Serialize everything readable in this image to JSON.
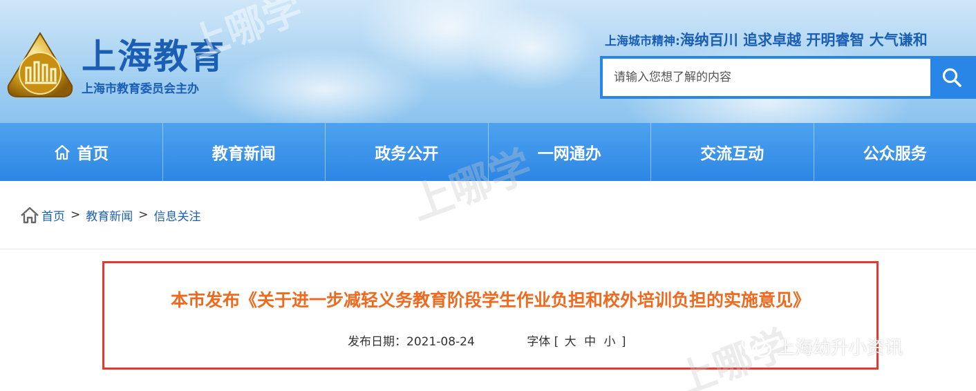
{
  "header": {
    "site_title": "上海教育",
    "site_subtitle": "上海市教育委员会主办",
    "spirit_lead": "上海城市精神:",
    "spirit_text": "海纳百川 追求卓越 开明睿智 大气谦和"
  },
  "search": {
    "placeholder": "请输入您想了解的内容",
    "icon": "search-icon"
  },
  "nav": {
    "items": [
      {
        "label": "首页",
        "icon": "home-icon"
      },
      {
        "label": "教育新闻"
      },
      {
        "label": "政务公开"
      },
      {
        "label": "一网通办"
      },
      {
        "label": "交流互动"
      },
      {
        "label": "公众服务"
      }
    ]
  },
  "breadcrumb": {
    "items": [
      "首页",
      "教育新闻",
      "信息关注"
    ],
    "separator": ">"
  },
  "article": {
    "title": "本市发布《关于进一步减轻义务教育阶段学生作业负担和校外培训负担的实施意见》",
    "date_label": "发布日期：",
    "date": "2021-08-24",
    "font_label": "字体",
    "font_open": "[",
    "font_large": "大",
    "font_medium": "中",
    "font_small": "小",
    "font_close": "]"
  },
  "watermark": {
    "brand": "上哪学",
    "wechat_account": "上海幼升小资讯"
  },
  "colors": {
    "nav_blue": "#2c86e4",
    "title_orange": "#ef6a1e",
    "frame_red": "#e23a32",
    "link_blue": "#1a5fb4"
  }
}
